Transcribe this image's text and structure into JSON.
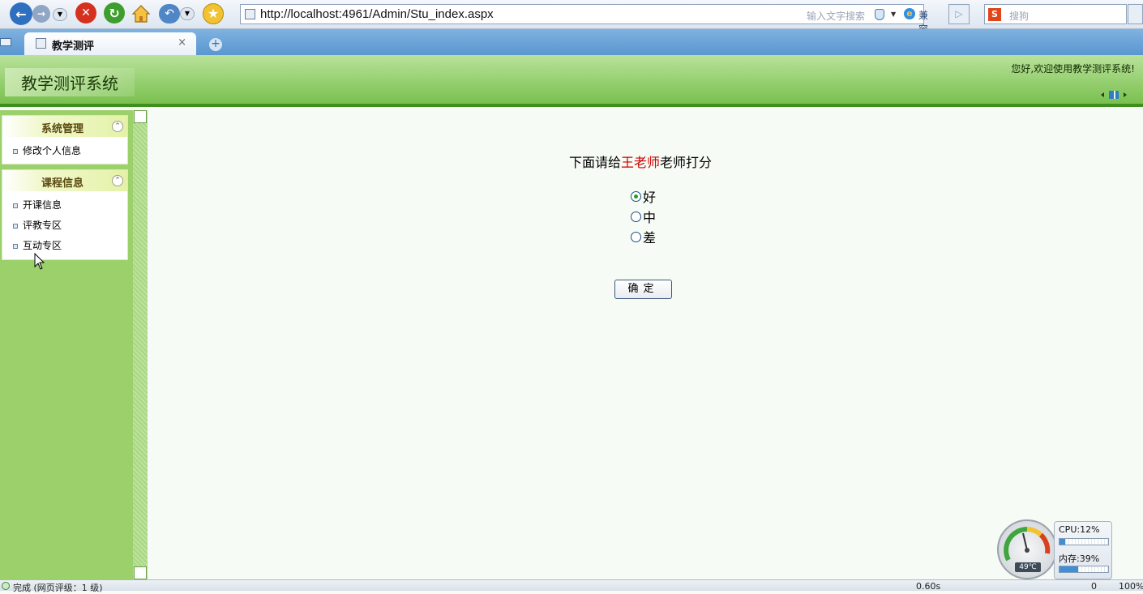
{
  "browser": {
    "url": "http://localhost:4961/Admin/Stu_index.aspx",
    "search_hint": "输入文字搜索",
    "compat_label": "兼容",
    "search_placeholder": "搜狗",
    "search_engine_icon": "S"
  },
  "tab": {
    "title": "教学测评",
    "close": "×",
    "new": "+"
  },
  "header": {
    "system_title": "教学测评系统",
    "welcome": "您好,欢迎使用教学测评系统!"
  },
  "sidebar": {
    "panels": [
      {
        "title": "系统管理",
        "items": [
          "修改个人信息"
        ]
      },
      {
        "title": "课程信息",
        "items": [
          "开课信息",
          "评教专区",
          "互动专区"
        ]
      }
    ]
  },
  "main": {
    "prompt_before": "下面请给",
    "teacher_name": "王老师",
    "prompt_after": "老师打分",
    "options": [
      {
        "label": "好",
        "checked": true
      },
      {
        "label": "中",
        "checked": false
      },
      {
        "label": "差",
        "checked": false
      }
    ],
    "confirm_label": "确定"
  },
  "widget": {
    "cpu_label": "CPU:12%",
    "cpu_percent": 12,
    "mem_label": "内存:39%",
    "mem_percent": 39,
    "temperature": "49℃"
  },
  "statusbar": {
    "status_text": "完成 (网页评级：1 级)",
    "load_time": "0.60s",
    "count": "0",
    "zoom": "100%"
  },
  "colors": {
    "header_green": "#79c04f",
    "sidebar_green": "#9bd06a",
    "teacher_red": "#cc0000",
    "radio_checked": "#21a121"
  }
}
